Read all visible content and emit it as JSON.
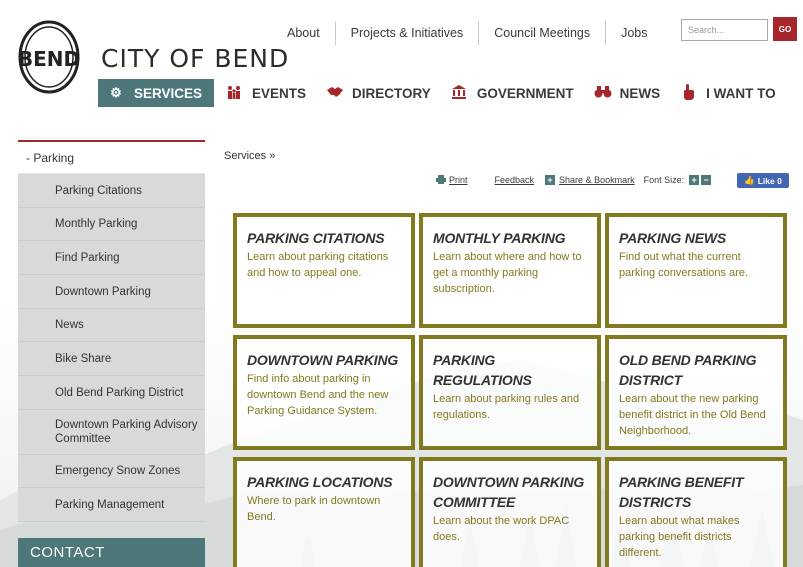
{
  "site": {
    "title": "CITY OF BEND",
    "logo_text": "BEND"
  },
  "top_nav": [
    {
      "label": "About"
    },
    {
      "label": "Projects & Initiatives"
    },
    {
      "label": "Council Meetings"
    },
    {
      "label": "Jobs"
    }
  ],
  "search": {
    "placeholder": "Search...",
    "go_label": "GO"
  },
  "main_nav": [
    {
      "label": "SERVICES",
      "icon": "gears-icon",
      "glyph": "⚙",
      "active": true
    },
    {
      "label": "EVENTS",
      "icon": "people-icon",
      "glyph": "👪",
      "active": false
    },
    {
      "label": "DIRECTORY",
      "icon": "handshake-icon",
      "glyph": "🤝",
      "active": false
    },
    {
      "label": "GOVERNMENT",
      "icon": "capitol-icon",
      "glyph": "🏛",
      "active": false
    },
    {
      "label": "NEWS",
      "icon": "binoculars-icon",
      "glyph": "∞",
      "active": false
    },
    {
      "label": "I WANT TO",
      "icon": "pointer-icon",
      "glyph": "☝",
      "active": false
    }
  ],
  "sidebar": {
    "head": "- Parking",
    "items": [
      {
        "label": "Parking Citations"
      },
      {
        "label": "Monthly Parking"
      },
      {
        "label": "Find Parking"
      },
      {
        "label": "Downtown Parking"
      },
      {
        "label": "News"
      },
      {
        "label": "Bike Share"
      },
      {
        "label": "Old Bend Parking District"
      },
      {
        "label": "Downtown Parking Advisory Committee"
      },
      {
        "label": "Emergency Snow Zones"
      },
      {
        "label": "Parking Management"
      }
    ],
    "contact": "CONTACT"
  },
  "breadcrumb": "Services »",
  "tools": {
    "print": "Print",
    "feedback": "Feedback",
    "share": "Share & Bookmark",
    "font_size": "Font Size:",
    "like": "Like 0"
  },
  "cards": [
    {
      "title": "PARKING CITATIONS",
      "desc": "Learn about parking citations and how to appeal one."
    },
    {
      "title": "MONTHLY PARKING",
      "desc": "Learn about where and how to get a monthly parking subscription."
    },
    {
      "title": "PARKING NEWS",
      "desc": "Find out what the current parking conversations are."
    },
    {
      "title": "DOWNTOWN PARKING",
      "desc": "Find info about parking in downtown Bend and the new Parking Guidance System."
    },
    {
      "title": "PARKING REGULATIONS",
      "desc": "Learn about parking rules and regulations."
    },
    {
      "title": "OLD BEND PARKING DISTRICT",
      "desc": "Learn about the new parking benefit district in the Old Bend Neighborhood."
    },
    {
      "title": "PARKING LOCATIONS",
      "desc": "Where to park in downtown Bend."
    },
    {
      "title": "DOWNTOWN PARKING COMMITTEE",
      "desc": "Learn about the work DPAC does."
    },
    {
      "title": "PARKING BENEFIT DISTRICTS",
      "desc": "Learn about what makes parking benefit districts different."
    }
  ],
  "colors": {
    "accent_red": "#a6262c",
    "teal": "#4d7778",
    "olive": "#827a1f"
  }
}
